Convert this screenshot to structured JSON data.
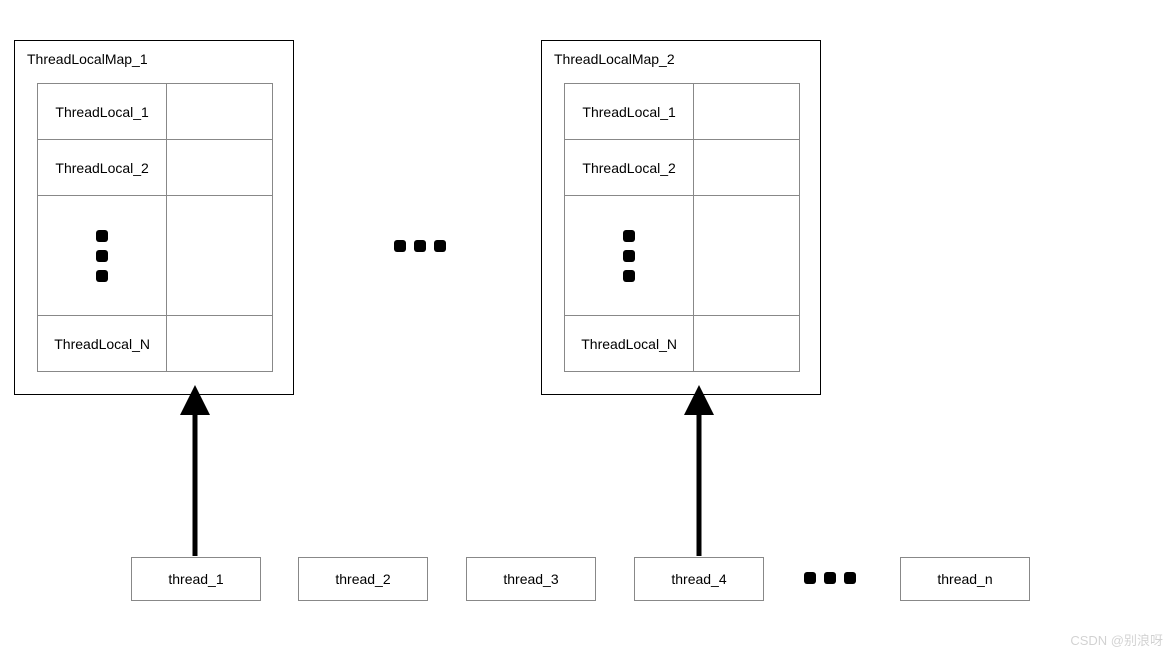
{
  "maps": [
    {
      "title": "ThreadLocalMap_1",
      "rows": [
        "ThreadLocal_1",
        "ThreadLocal_2",
        "...",
        "ThreadLocal_N"
      ]
    },
    {
      "title": "ThreadLocalMap_2",
      "rows": [
        "ThreadLocal_1",
        "ThreadLocal_2",
        "...",
        "ThreadLocal_N"
      ]
    }
  ],
  "center_ellipsis": "...",
  "threads": [
    {
      "label": "thread_1"
    },
    {
      "label": "thread_2"
    },
    {
      "label": "thread_3"
    },
    {
      "label": "thread_4"
    },
    {
      "label": "thread_n"
    }
  ],
  "thread_row_ellipsis": "...",
  "watermark": "CSDN @别浪呀"
}
